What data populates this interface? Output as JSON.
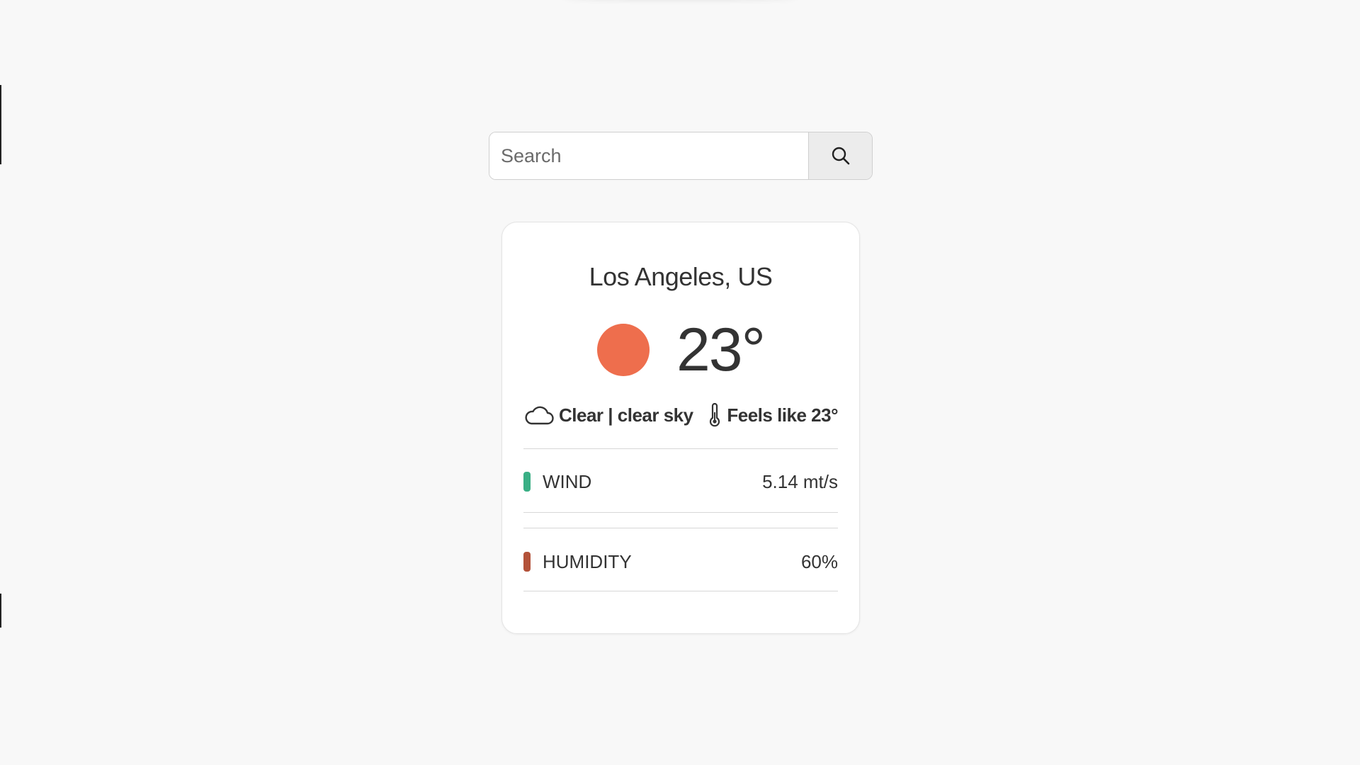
{
  "search": {
    "placeholder": "Search",
    "value": "",
    "button_icon": "search-icon"
  },
  "weather": {
    "city": "Los Angeles, US",
    "temperature": "23°",
    "condition_icon": "sun-icon",
    "condition_text": "Clear | clear sky",
    "feels_like": "Feels like 23°",
    "stats": [
      {
        "label": "WIND",
        "value": "5.14 mt/s",
        "color": "#3aaf85"
      },
      {
        "label": "HUMIDITY",
        "value": "60%",
        "color": "#b3523a"
      }
    ]
  },
  "colors": {
    "sun": "#ee6e4d",
    "background": "#f8f8f8",
    "card": "#ffffff"
  }
}
